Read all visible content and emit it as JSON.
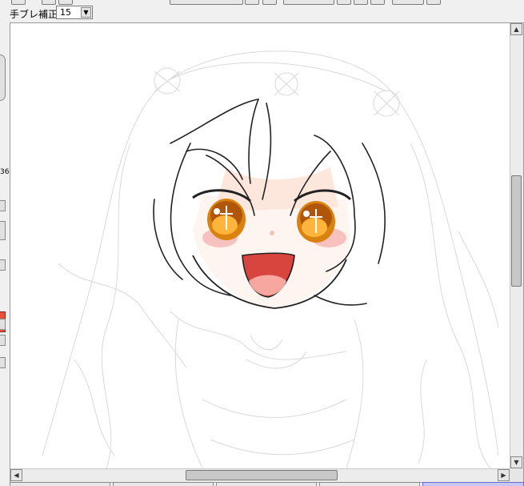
{
  "toolbar": {
    "stabilizer_label": "手ブレ補正",
    "stabilizer_value": "15"
  },
  "left_panel": {
    "truncated_value": "36"
  },
  "colors": {
    "primary_color": "#e8503a",
    "hair_line": "#222222",
    "eye_iris": "#d9820f",
    "blush": "#f6b7b7",
    "mouth": "#d8453e"
  }
}
